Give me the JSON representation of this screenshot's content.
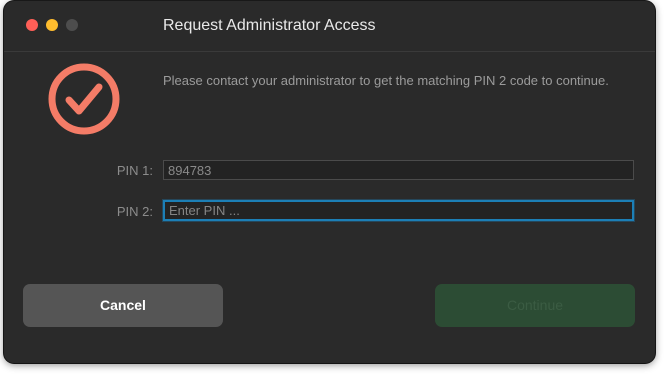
{
  "window": {
    "title": "Request Administrator Access"
  },
  "colors": {
    "accent_icon": "#f47c67",
    "focus_ring": "#1c7fb6",
    "continue_button": "#2c4c34"
  },
  "status_icon": "checkmark-circle-icon",
  "message": "Please contact your administrator to get the matching PIN 2 code to continue.",
  "form": {
    "pin1_label": "PIN 1:",
    "pin1_placeholder": "894783",
    "pin2_label": "PIN 2:",
    "pin2_placeholder": "Enter PIN ..."
  },
  "buttons": {
    "cancel_label": "Cancel",
    "continue_label": "Continue"
  }
}
